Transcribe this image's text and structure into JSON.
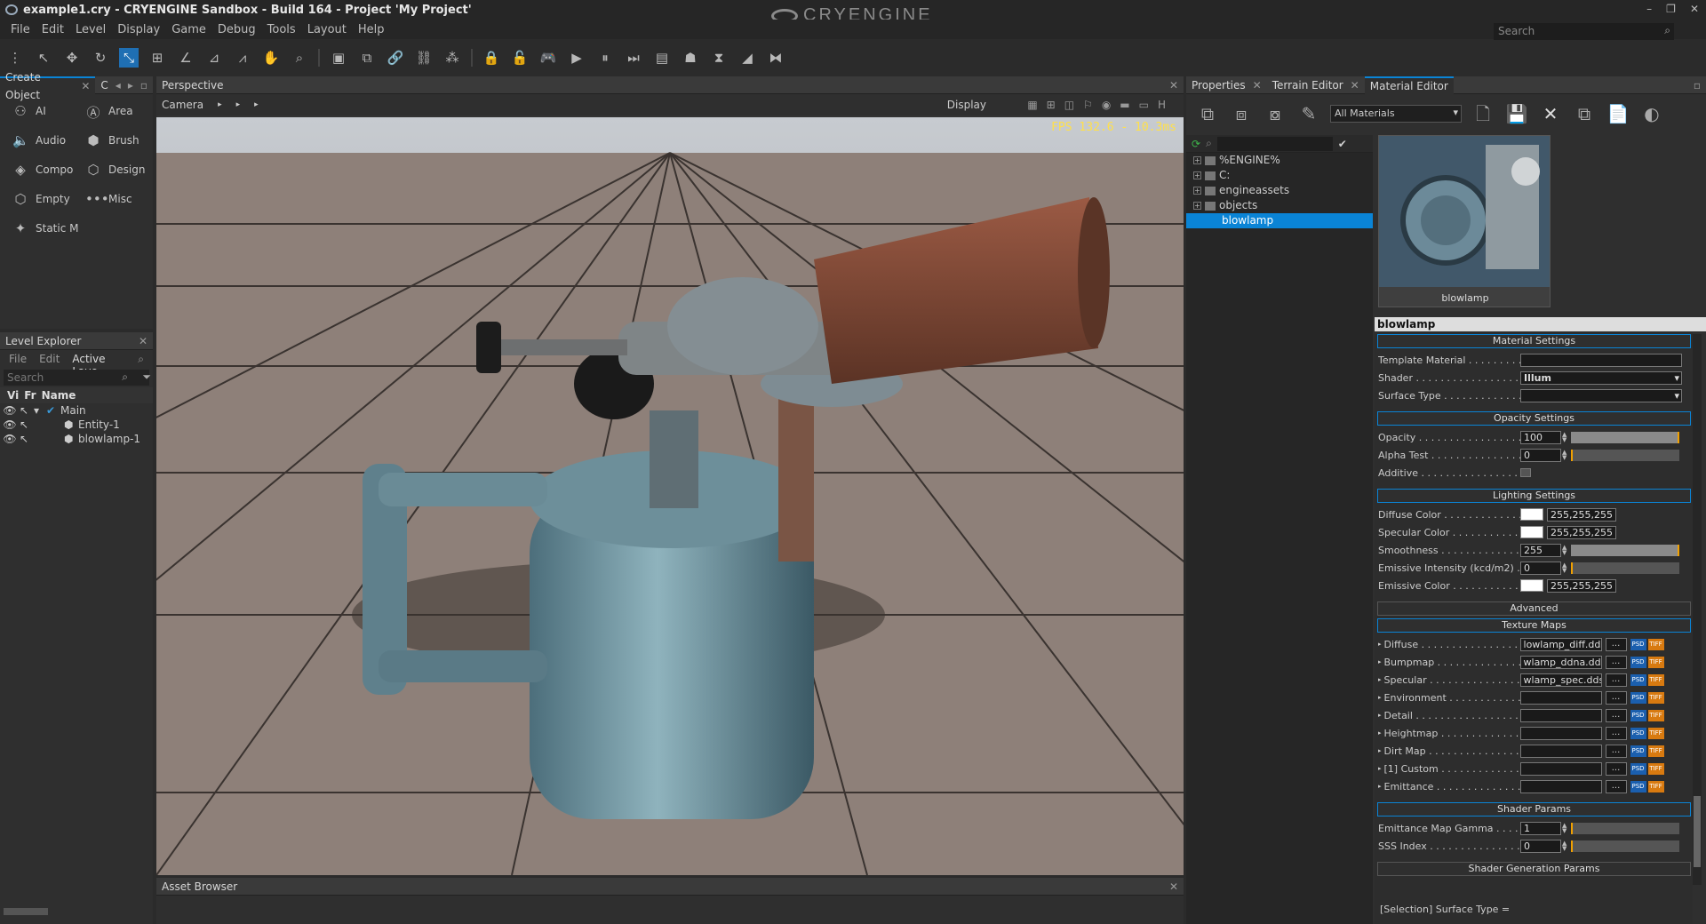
{
  "window": {
    "title": "example1.cry - CRYENGINE Sandbox - Build 164 - Project 'My Project'",
    "brand": "CRYENGINE",
    "minimize": "–",
    "restore": "❐",
    "close": "✕"
  },
  "menu": [
    "File",
    "Edit",
    "Level",
    "Display",
    "Game",
    "Debug",
    "Tools",
    "Layout",
    "Help"
  ],
  "search": {
    "placeholder": "Search"
  },
  "create_object": {
    "tab": "Create Object",
    "tab2": "C",
    "items": [
      {
        "label": "AI",
        "icon": "ai-icon"
      },
      {
        "label": "Area",
        "icon": "area-icon"
      },
      {
        "label": "Audio",
        "icon": "audio-icon"
      },
      {
        "label": "Brush",
        "icon": "brush-icon"
      },
      {
        "label": "Compo",
        "icon": "component-icon"
      },
      {
        "label": "Design",
        "icon": "designer-icon"
      },
      {
        "label": "Empty",
        "icon": "empty-icon"
      },
      {
        "label": "Misc",
        "icon": "misc-icon"
      },
      {
        "label": "Static M",
        "icon": "static-mesh-icon"
      }
    ]
  },
  "level_explorer": {
    "title": "Level Explorer",
    "menu": [
      "File",
      "Edit"
    ],
    "active_layer": "Active Laye",
    "search_placeholder": "Search",
    "columns": [
      "Vi",
      "Fr",
      "Name"
    ],
    "rows": [
      {
        "name": "Main",
        "indent": 1
      },
      {
        "name": "Entity-1",
        "indent": 2
      },
      {
        "name": "blowlamp-1",
        "indent": 2
      }
    ]
  },
  "viewport": {
    "title": "Perspective",
    "camera": "Camera",
    "display": "Display",
    "fps": "FPS 132.6 - 10.3ms"
  },
  "asset_browser": {
    "title": "Asset Browser"
  },
  "right_tabs": [
    "Properties",
    "Terrain Editor",
    "Material Editor"
  ],
  "material_editor": {
    "filter": "All Materials",
    "library": [
      "%ENGINE%",
      "C:",
      "engineassets",
      "objects",
      "blowlamp"
    ],
    "preview_label": "blowlamp",
    "material_name": "blowlamp",
    "sections": {
      "material_settings": "Material Settings",
      "opacity_settings": "Opacity Settings",
      "lighting_settings": "Lighting Settings",
      "advanced": "Advanced",
      "texture_maps": "Texture Maps",
      "shader_params": "Shader Params",
      "shader_generation_params": "Shader Generation Params"
    },
    "material": {
      "template_label": "Template Material",
      "template_value": "",
      "shader_label": "Shader",
      "shader_value": "Illum",
      "surface_label": "Surface Type",
      "surface_value": ""
    },
    "opacity": {
      "opacity_label": "Opacity",
      "opacity_value": "100",
      "opacity_fraction": 1.0,
      "alpha_label": "Alpha Test",
      "alpha_value": "0",
      "alpha_fraction": 0.0,
      "additive_label": "Additive"
    },
    "lighting": {
      "diffuse_label": "Diffuse Color",
      "diffuse_value": "255,255,255",
      "diffuse_color": "#ffffff",
      "specular_label": "Specular Color",
      "specular_value": "255,255,255",
      "specular_color": "#ffffff",
      "smooth_label": "Smoothness",
      "smooth_value": "255",
      "smooth_fraction": 1.0,
      "emis_int_label": "Emissive Intensity (kcd/m2)",
      "emis_int_value": "0",
      "emis_int_fraction": 0.0,
      "emis_label": "Emissive Color",
      "emis_value": "255,255,255",
      "emis_color": "#ffffff"
    },
    "textures": [
      {
        "label": "Diffuse",
        "value": "lowlamp_diff.dds"
      },
      {
        "label": "Bumpmap",
        "value": "wlamp_ddna.dds"
      },
      {
        "label": "Specular",
        "value": "wlamp_spec.dds"
      },
      {
        "label": "Environment",
        "value": ""
      },
      {
        "label": "Detail",
        "value": ""
      },
      {
        "label": "Heightmap",
        "value": ""
      },
      {
        "label": "Dirt Map",
        "value": ""
      },
      {
        "label": "[1] Custom",
        "value": ""
      },
      {
        "label": "Emittance",
        "value": ""
      }
    ],
    "texture_btn": "...",
    "psd": "PSD",
    "tiff": "TIFF",
    "shader_params": [
      {
        "label": "Emittance Map Gamma",
        "value": "1",
        "fraction": 0.0
      },
      {
        "label": "SSS Index",
        "value": "0",
        "fraction": 0.0
      }
    ],
    "status": "[Selection] Surface Type ="
  },
  "colors": {
    "accent": "#0a84d6",
    "fps": "#ffe04a",
    "selection": "#0a84d6"
  }
}
